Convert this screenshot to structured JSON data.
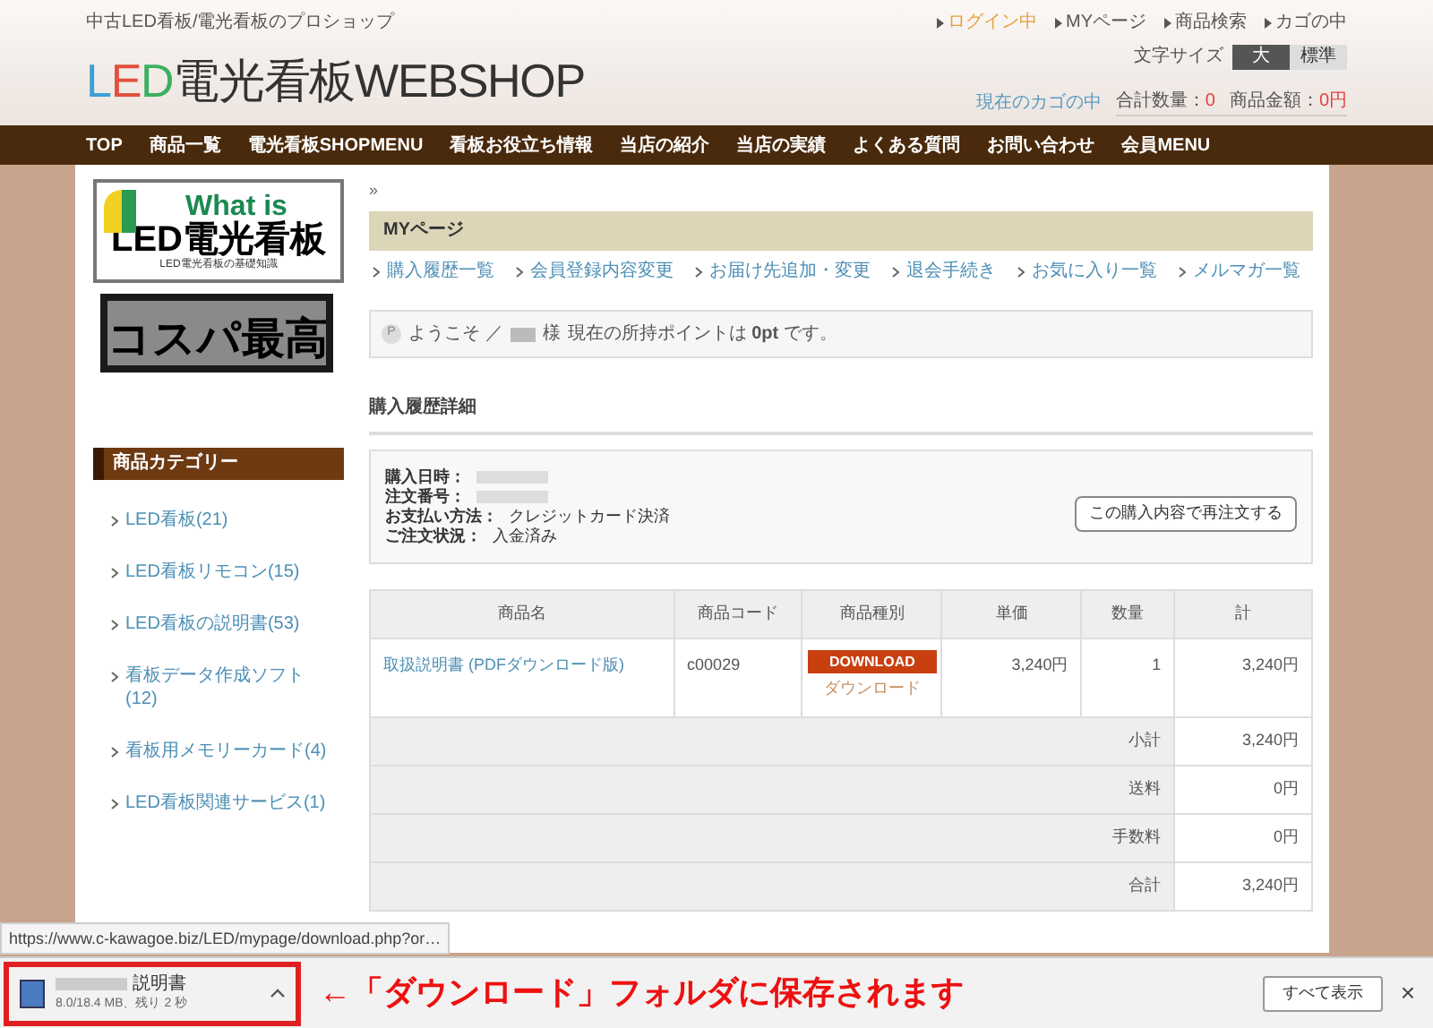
{
  "header": {
    "tagline": "中古LED看板/電光看板のプロショップ",
    "logo": "LED電光看板WEBSHOP",
    "top_links": [
      {
        "label": "ログイン中",
        "active": true
      },
      {
        "label": "MYページ",
        "active": false
      },
      {
        "label": "商品検索",
        "active": false
      },
      {
        "label": "カゴの中",
        "active": false
      }
    ],
    "font_size": {
      "label": "文字サイズ",
      "options": [
        {
          "label": "大",
          "selected": true
        },
        {
          "label": "標準",
          "selected": false
        }
      ]
    },
    "cart": {
      "label": "現在のカゴの中",
      "quantity_label": "合計数量：",
      "quantity": "0",
      "amount_label": "商品金額：",
      "amount": "0円"
    }
  },
  "nav": [
    "TOP",
    "商品一覧",
    "電光看板SHOPMENU",
    "看板お役立ち情報",
    "当店の紹介",
    "当店の実績",
    "よくある質問",
    "お問い合わせ",
    "会員MENU"
  ],
  "sidebar": {
    "banner_1": {
      "title_1": "What is",
      "title_2": "LED電光看板",
      "subtitle": "LED電光看板の基礎知識"
    },
    "banner_2": "コスパ最高",
    "category_title": "商品カテゴリー",
    "categories": [
      "LED看板(21)",
      "LED看板リモコン(15)",
      "LED看板の説明書(53)",
      "看板データ作成ソフト(12)",
      "看板用メモリーカード(4)",
      "LED看板関連サービス(1)"
    ]
  },
  "breadcrumb": "»",
  "mypage": {
    "title": "MYページ",
    "links": [
      "購入履歴一覧",
      "会員登録内容変更",
      "お届け先追加・変更",
      "退会手続き",
      "お気に入り一覧",
      "メルマガ一覧"
    ],
    "welcome": {
      "icon_letter": "P",
      "text": "ようこそ ／",
      "name_suffix": "様",
      "points": "現在の所持ポイントは **0pt** です。"
    }
  },
  "order": {
    "title": "購入履歴詳細",
    "fields": [
      {
        "label": "購入日時："
      },
      {
        "label": "注文番号："
      },
      {
        "label": "お支払い方法：",
        "value": "クレジットカード決済"
      },
      {
        "label": "ご注文状況：",
        "value": "入金済み"
      }
    ],
    "reorder_button": "この購入内容で再注文する",
    "table": {
      "columns": [
        "商品名",
        "商品コード",
        "商品種別",
        "単価",
        "数量",
        "計"
      ],
      "rows": [
        {
          "name": "取扱説明書 (PDFダウンロード版)",
          "code": "c00029",
          "download_button": "DOWNLOAD",
          "download_note": "ダウンロード",
          "price": "3,240円",
          "quantity": "1",
          "total": "3,240円"
        }
      ],
      "summary": [
        {
          "label": "小計",
          "value": "3,240円"
        },
        {
          "label": "送料",
          "value": "0円"
        },
        {
          "label": "手数料",
          "value": "0円"
        },
        {
          "label": "合計",
          "value": "3,240円"
        }
      ]
    }
  },
  "status_url": "https://www.c-kawagoe.biz/LED/mypage/download.php?or…",
  "download_bar": {
    "file": "説明書",
    "progress": "8.0/18.4 MB、残り 2 秒",
    "annotation": "←「ダウンロード」フォルダに保存されます",
    "show_all": "すべて表示",
    "close": "×"
  }
}
